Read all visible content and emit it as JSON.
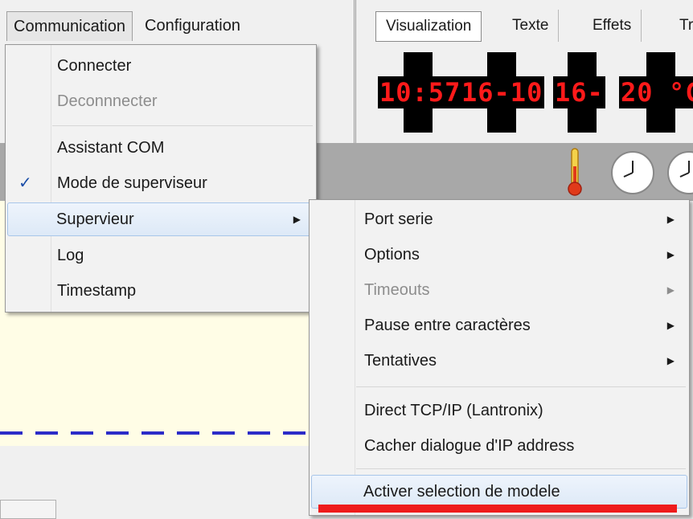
{
  "menubar": {
    "items": [
      {
        "label": "Communication"
      },
      {
        "label": "Configuration"
      }
    ]
  },
  "tabs": [
    {
      "label": "Visualization"
    },
    {
      "label": "Texte"
    },
    {
      "label": "Effets"
    },
    {
      "label": "Tr"
    }
  ],
  "display": {
    "segments": [
      "10:57",
      "16-10",
      "16-",
      "20",
      "°C"
    ]
  },
  "communication_menu": {
    "items": [
      {
        "label": "Connecter",
        "enabled": true
      },
      {
        "label": "Deconnnecter",
        "enabled": false
      },
      {
        "label": "Assistant COM",
        "enabled": true
      },
      {
        "label": "Mode de superviseur",
        "enabled": true,
        "checked": true
      },
      {
        "label": "Supervieur",
        "enabled": true,
        "submenu": true,
        "highlighted": true
      },
      {
        "label": "Log",
        "enabled": true
      },
      {
        "label": "Timestamp",
        "enabled": true
      }
    ],
    "checkmark": "✓"
  },
  "supervieur_submenu": {
    "items": [
      {
        "label": "Port serie",
        "submenu": true,
        "enabled": true
      },
      {
        "label": "Options",
        "submenu": true,
        "enabled": true
      },
      {
        "label": "Timeouts",
        "submenu": true,
        "enabled": false
      },
      {
        "label": "Pause entre caractères",
        "submenu": true,
        "enabled": true
      },
      {
        "label": "Tentatives",
        "submenu": true,
        "enabled": true
      },
      {
        "label": "Direct TCP/IP (Lantronix)",
        "enabled": true
      },
      {
        "label": "Cacher dialogue d'IP address",
        "enabled": true
      },
      {
        "label": "Activer selection de modele",
        "enabled": true,
        "highlighted": true
      }
    ]
  },
  "icons": {
    "submenu_arrow": "▶",
    "thermometer": "thermometer-icon",
    "clock": "clock-icon"
  },
  "colors": {
    "led_text": "#ff1a1a",
    "highlight": "#dde9f7",
    "annotation_underline": "#ee1c1c",
    "dash_line": "#2c2cc8"
  }
}
